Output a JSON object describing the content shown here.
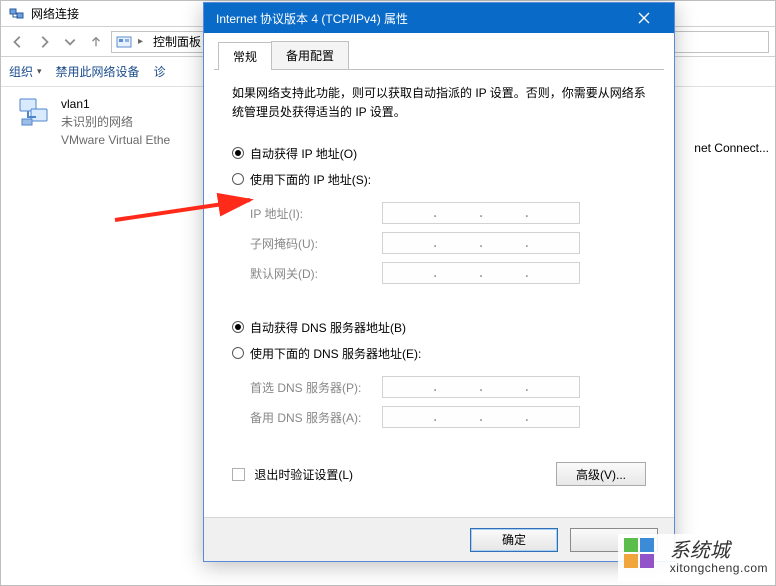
{
  "explorer": {
    "title": "网络连接",
    "breadcrumb": {
      "item1": "控制面板",
      "chev": "▸"
    },
    "toolbar": {
      "organize": "组织",
      "disable": "禁用此网络设备",
      "diagnose": "诊"
    },
    "netitem": {
      "name": "vlan1",
      "line2": "未识别的网络",
      "line3": "VMware Virtual Ethe"
    },
    "peek": "net Connect..."
  },
  "dialog": {
    "title": "Internet 协议版本 4 (TCP/IPv4) 属性",
    "tabs": {
      "general": "常规",
      "alt": "备用配置"
    },
    "desc": "如果网络支持此功能，则可以获取自动指派的 IP 设置。否则，你需要从网络系统管理员处获得适当的 IP 设置。",
    "radios": {
      "auto_ip": "自动获得 IP 地址(O)",
      "manual_ip": "使用下面的 IP 地址(S):",
      "auto_dns": "自动获得 DNS 服务器地址(B)",
      "manual_dns": "使用下面的 DNS 服务器地址(E):"
    },
    "fields": {
      "ip": "IP 地址(I):",
      "mask": "子网掩码(U):",
      "gw": "默认网关(D):",
      "pdns": "首选 DNS 服务器(P):",
      "adns": "备用 DNS 服务器(A):"
    },
    "validate": "退出时验证设置(L)",
    "advanced": "高级(V)...",
    "ok": "确定",
    "cancel": ""
  },
  "watermark": {
    "name": "系统城",
    "url": "xitongcheng.com"
  }
}
